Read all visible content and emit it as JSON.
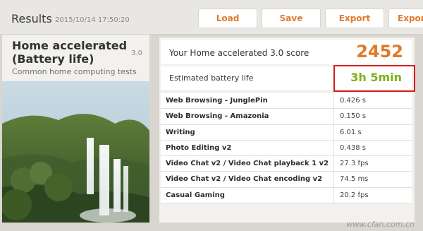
{
  "header": {
    "title": "Results",
    "timestamp": "2015/10/14 17:50:20",
    "buttons": {
      "load": "Load",
      "save": "Save",
      "export1": "Export",
      "export2": "Export"
    }
  },
  "test": {
    "name": "Home accelerated (Battery life)",
    "version": "3.0",
    "description": "Common home computing tests"
  },
  "score": {
    "label": "Your Home accelerated 3.0 score",
    "value": "2452"
  },
  "battery": {
    "label": "Estimated battery life",
    "value": "3h 5min"
  },
  "results": [
    {
      "name": "Web Browsing - JunglePin",
      "value": "0.426 s"
    },
    {
      "name": "Web Browsing - Amazonia",
      "value": "0.150 s"
    },
    {
      "name": "Writing",
      "value": "6.01 s"
    },
    {
      "name": "Photo Editing v2",
      "value": "0.438 s"
    },
    {
      "name": "Video Chat v2 / Video Chat playback 1 v2",
      "value": "27.3 fps"
    },
    {
      "name": "Video Chat v2 / Video Chat encoding v2",
      "value": "74.5 ms"
    },
    {
      "name": "Casual Gaming",
      "value": "20.2 fps"
    }
  ],
  "watermark": "www.cfan.com.cn",
  "colors": {
    "accent_orange": "#e07a2a",
    "battery_green": "#7ab317",
    "highlight_red": "#d91c1c"
  }
}
